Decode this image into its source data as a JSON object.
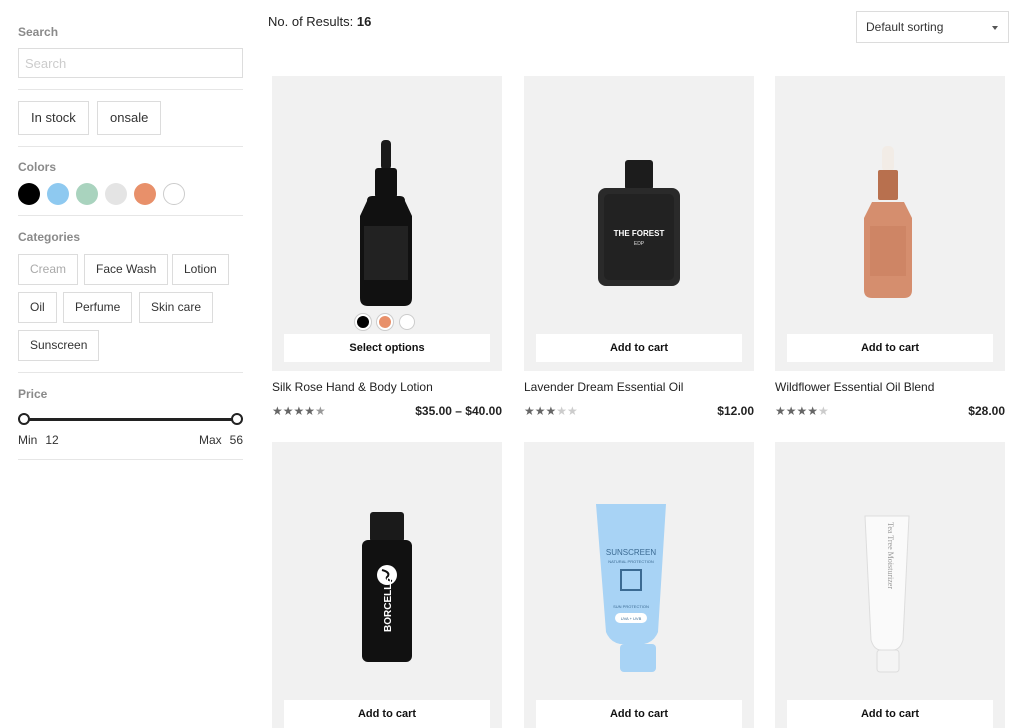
{
  "sidebar": {
    "search": {
      "title": "Search",
      "placeholder": "Search"
    },
    "stock_filters": [
      "In stock",
      "onsale"
    ],
    "colors": {
      "title": "Colors",
      "swatches": [
        "#000000",
        "#8ec9f0",
        "#a9d3be",
        "#e4e4e4",
        "#e8906a",
        "#ffffff"
      ]
    },
    "categories": {
      "title": "Categories",
      "items": [
        "Cream",
        "Face Wash",
        "Lotion",
        "Oil",
        "Perfume",
        "Skin care",
        "Sunscreen"
      ]
    },
    "price": {
      "title": "Price",
      "min_label": "Min",
      "min_value": "12",
      "max_label": "Max",
      "max_value": "56"
    }
  },
  "toolbar": {
    "results_label": "No. of Results:",
    "results_count": "16",
    "sort_label": "Default sorting"
  },
  "products": [
    {
      "title": "Silk Rose Hand & Body Lotion",
      "price": "$35.00 – $40.00",
      "rating": 4.5,
      "button": "Select options",
      "option_colors": [
        "#000000",
        "#e8906a",
        "#ffffff"
      ],
      "icon": "dropper-bottle-black-icon"
    },
    {
      "title": "Lavender Dream Essential Oil",
      "price": "$12.00",
      "rating": 3,
      "button": "Add to cart",
      "icon": "perfume-bottle-icon",
      "bottle_text": [
        "THE FOREST",
        "EDP"
      ]
    },
    {
      "title": "Wildflower Essential Oil Blend",
      "price": "$28.00",
      "rating": 4,
      "button": "Add to cart",
      "icon": "dropper-bottle-rose-icon"
    },
    {
      "title": "",
      "price": "",
      "rating": 0,
      "button": "Add to cart",
      "icon": "serum-bottle-icon",
      "bottle_text": [
        "BORCELLE"
      ]
    },
    {
      "title": "",
      "price": "",
      "rating": 0,
      "button": "Add to cart",
      "icon": "sunscreen-tube-icon",
      "bottle_text": [
        "SUNSCREEN",
        "NATURAL PROTECTION",
        "SUN PROTECTION",
        "UVA + UVB"
      ]
    },
    {
      "title": "",
      "price": "",
      "rating": 0,
      "button": "Add to cart",
      "icon": "moisturizer-tube-icon",
      "bottle_text": [
        "Tea Tree Moisturizer"
      ]
    }
  ]
}
